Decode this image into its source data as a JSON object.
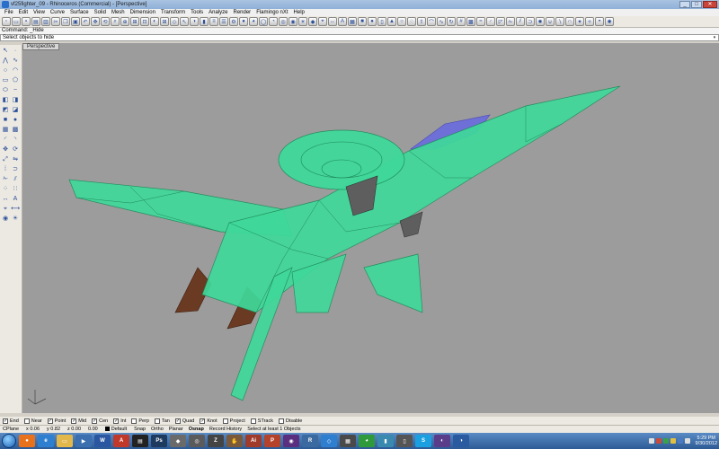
{
  "window": {
    "title": "vf25fighter_09 - Rhinoceros (Commercial) - [Perspective]",
    "controls": [
      "_",
      "□",
      "✕"
    ]
  },
  "menu": [
    "File",
    "Edit",
    "View",
    "Curve",
    "Surface",
    "Solid",
    "Mesh",
    "Dimension",
    "Transform",
    "Tools",
    "Analyze",
    "Render",
    "Flamingo nXt",
    "Help"
  ],
  "command": {
    "history": "Command: _Hide",
    "prompt": "Select objects to hide"
  },
  "viewport": {
    "label": "Perspective",
    "background": "#9c9c9c",
    "model_color": "#3fd99a"
  },
  "osnaps": [
    {
      "label": "End",
      "checked": true
    },
    {
      "label": "Near",
      "checked": false
    },
    {
      "label": "Point",
      "checked": true
    },
    {
      "label": "Mid",
      "checked": true
    },
    {
      "label": "Cen",
      "checked": true
    },
    {
      "label": "Int",
      "checked": true
    },
    {
      "label": "Perp",
      "checked": false
    },
    {
      "label": "Tan",
      "checked": false
    },
    {
      "label": "Quad",
      "checked": true
    },
    {
      "label": "Knot",
      "checked": true
    },
    {
      "label": "Project",
      "checked": false
    },
    {
      "label": "STrack",
      "checked": false
    },
    {
      "label": "Disable",
      "checked": false
    }
  ],
  "status": {
    "cplane": "CPlane",
    "x": "x 0.06",
    "y": "y 0.82",
    "z": "z 0.00",
    "dist": "0.00",
    "layer": "Default",
    "snap": "Snap",
    "ortho": "Ortho",
    "planar": "Planar",
    "osnap": "Osnap",
    "history": "Record History",
    "message": "Select at least 1 Objects"
  },
  "taskbar": {
    "time": "5:29 PM",
    "date": "9/30/2012"
  }
}
